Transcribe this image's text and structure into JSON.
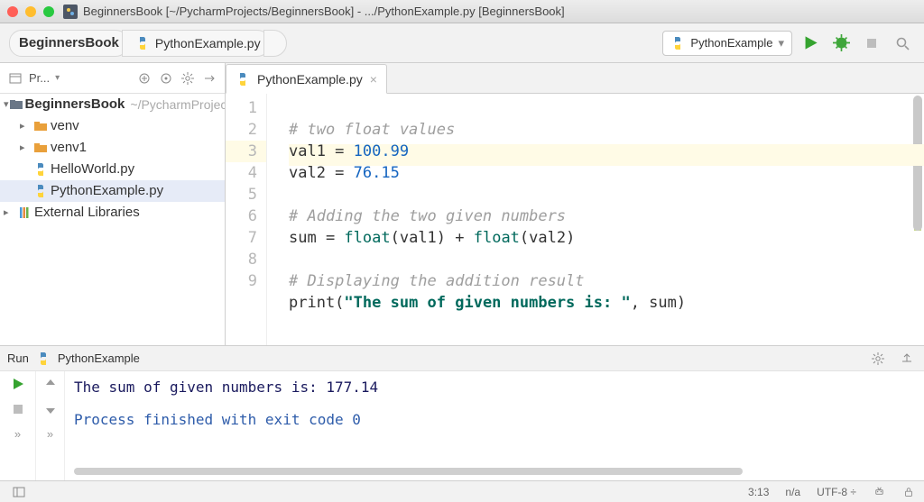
{
  "window": {
    "title": "BeginnersBook [~/PycharmProjects/BeginnersBook] - .../PythonExample.py [BeginnersBook]"
  },
  "breadcrumbs": {
    "project": "BeginnersBook",
    "file": "PythonExample.py"
  },
  "run_config": {
    "name": "PythonExample"
  },
  "project_panel": {
    "label": "Pr...",
    "root": {
      "name": "BeginnersBook",
      "path": "~/PycharmProjects/BeginnersBook"
    },
    "items": [
      {
        "name": "venv",
        "kind": "folder"
      },
      {
        "name": "venv1",
        "kind": "folder"
      },
      {
        "name": "HelloWorld.py",
        "kind": "py"
      },
      {
        "name": "PythonExample.py",
        "kind": "py",
        "selected": true
      }
    ],
    "external": "External Libraries"
  },
  "editor": {
    "tab": "PythonExample.py",
    "current_line": 3,
    "lines": [
      {
        "n": 1,
        "tokens": [
          {
            "t": "# two float values",
            "c": "c-comment"
          }
        ]
      },
      {
        "n": 2,
        "tokens": [
          {
            "t": "val1 = "
          },
          {
            "t": "100.99",
            "c": "c-num"
          }
        ]
      },
      {
        "n": 3,
        "tokens": [
          {
            "t": "val2 = "
          },
          {
            "t": "76.15",
            "c": "c-num"
          }
        ]
      },
      {
        "n": 4,
        "tokens": [
          {
            "t": ""
          }
        ]
      },
      {
        "n": 5,
        "tokens": [
          {
            "t": "# Adding the two given numbers",
            "c": "c-comment"
          }
        ]
      },
      {
        "n": 6,
        "tokens": [
          {
            "t": "sum = "
          },
          {
            "t": "float",
            "c": "c-fn"
          },
          {
            "t": "(val1) + "
          },
          {
            "t": "float",
            "c": "c-fn"
          },
          {
            "t": "(val2)"
          }
        ]
      },
      {
        "n": 7,
        "tokens": [
          {
            "t": ""
          }
        ]
      },
      {
        "n": 8,
        "tokens": [
          {
            "t": "# Displaying the addition result",
            "c": "c-comment"
          }
        ]
      },
      {
        "n": 9,
        "tokens": [
          {
            "t": "print("
          },
          {
            "t": "\"The sum of given numbers is: \"",
            "c": "c-str"
          },
          {
            "t": ", sum)"
          }
        ]
      }
    ]
  },
  "run": {
    "label": "Run",
    "config": "PythonExample",
    "output_line": "The sum of given numbers is:  177.14",
    "exit_line": "Process finished with exit code 0"
  },
  "status": {
    "cursor": "3:13",
    "insert": "n/a",
    "encoding": "UTF-8"
  }
}
